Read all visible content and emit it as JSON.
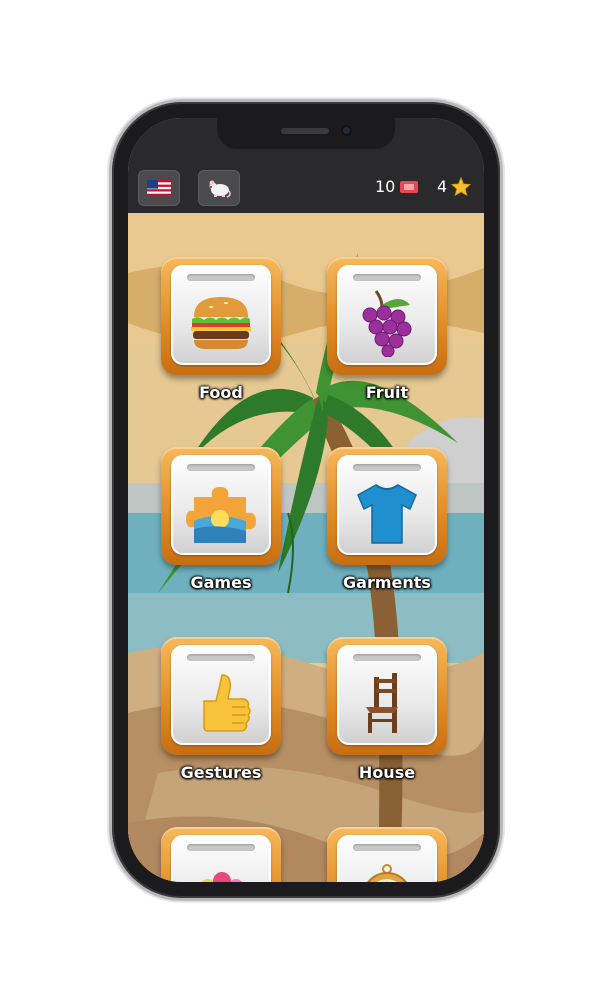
{
  "header": {
    "language_flag": "us-flag-icon",
    "mode_icon": "mouse-icon",
    "tickets_count": "10",
    "stars_count": "4"
  },
  "categories": [
    {
      "label": "Food",
      "icon": "burger-icon"
    },
    {
      "label": "Fruit",
      "icon": "grapes-icon"
    },
    {
      "label": "Games",
      "icon": "puzzle-icon"
    },
    {
      "label": "Garments",
      "icon": "tshirt-icon"
    },
    {
      "label": "Gestures",
      "icon": "thumbs-up-icon"
    },
    {
      "label": "House",
      "icon": "chair-icon"
    },
    {
      "label": "",
      "icon": "flowers-icon"
    },
    {
      "label": "",
      "icon": "compass-icon"
    }
  ],
  "colors": {
    "tile_orange": "#e08a22",
    "topbar": "#2a2a2c",
    "sand": "#e7c489"
  }
}
